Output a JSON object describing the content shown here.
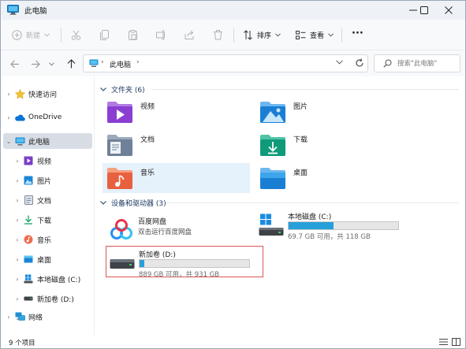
{
  "window": {
    "title": "此电脑",
    "icon": "computer-icon",
    "controls": [
      "minimize-icon",
      "maximize-icon",
      "close-icon"
    ]
  },
  "toolbar": {
    "new_label": "新建",
    "sort_label": "排序",
    "view_label": "查看",
    "more_label": "···",
    "disabled_icons": [
      "cut-icon",
      "copy-icon",
      "paste-icon",
      "rename-icon",
      "share-icon",
      "delete-icon"
    ]
  },
  "address": {
    "crumb": "此电脑",
    "separator": "›"
  },
  "search": {
    "placeholder": "搜索\"此电脑\""
  },
  "sidebar": {
    "items": [
      {
        "label": "快速访问",
        "icon": "star-icon"
      },
      {
        "label": "OneDrive",
        "icon": "cloud-icon"
      },
      {
        "label": "此电脑",
        "icon": "computer-icon"
      },
      {
        "label": "视频",
        "icon": "video-folder-icon"
      },
      {
        "label": "图片",
        "icon": "pictures-folder-icon"
      },
      {
        "label": "文档",
        "icon": "documents-folder-icon"
      },
      {
        "label": "下载",
        "icon": "downloads-icon"
      },
      {
        "label": "音乐",
        "icon": "music-icon"
      },
      {
        "label": "桌面",
        "icon": "desktop-folder-icon"
      },
      {
        "label": "本地磁盘 (C:)",
        "icon": "windows-drive-icon"
      },
      {
        "label": "新加卷 (D:)",
        "icon": "drive-icon"
      },
      {
        "label": "网络",
        "icon": "network-icon"
      }
    ]
  },
  "folders": {
    "header": "文件夹 (6)",
    "items": [
      {
        "label": "视频",
        "icon": "video-folder-icon"
      },
      {
        "label": "图片",
        "icon": "pictures-folder-icon"
      },
      {
        "label": "文档",
        "icon": "documents-folder-icon"
      },
      {
        "label": "下载",
        "icon": "downloads-folder-icon"
      },
      {
        "label": "音乐",
        "icon": "music-folder-icon"
      },
      {
        "label": "桌面",
        "icon": "desktop-folder-icon"
      }
    ]
  },
  "devices": {
    "header": "设备和驱动器 (3)",
    "items": [
      {
        "label": "百度网盘",
        "sub": "双击运行百度网盘",
        "icon": "baidu-netdisk-icon"
      },
      {
        "label": "本地磁盘 (C:)",
        "sub": "69.7 GB 可用，共 118 GB",
        "icon": "windows-drive-icon",
        "used_fraction": 0.41
      },
      {
        "label": "新加卷 (D:)",
        "sub": "889 GB 可用，共 931 GB",
        "icon": "drive-icon",
        "used_fraction": 0.045
      }
    ]
  },
  "status": {
    "count": "9 个项目"
  },
  "colors": {
    "accent": "#26a0da",
    "selected_bg": "#d8dde5",
    "hover_bg": "#e5f1fb",
    "group_header": "#1f3b63"
  }
}
